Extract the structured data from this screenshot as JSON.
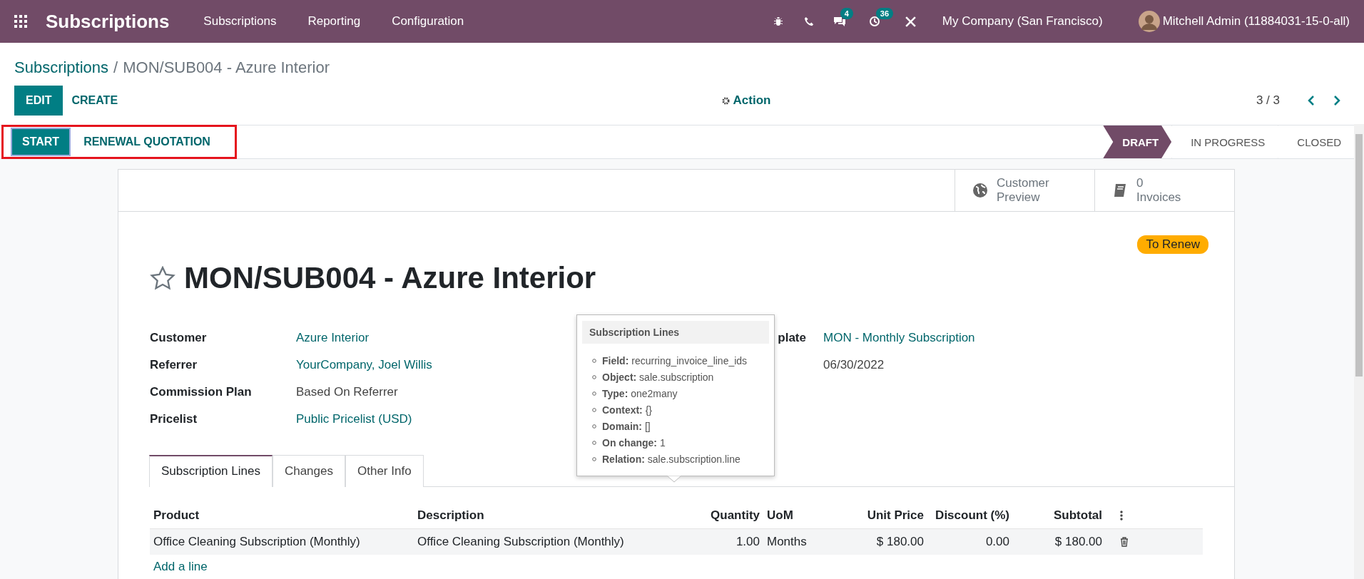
{
  "navbar": {
    "app_title": "Subscriptions",
    "menu": [
      "Subscriptions",
      "Reporting",
      "Configuration"
    ],
    "messages_badge": "4",
    "activities_badge": "36",
    "company": "My Company (San Francisco)",
    "user": "Mitchell Admin (11884031-15-0-all)"
  },
  "breadcrumb": {
    "parent": "Subscriptions",
    "separator": "/",
    "current": "MON/SUB004 - Azure Interior"
  },
  "control_panel": {
    "edit": "EDIT",
    "create": "CREATE",
    "action": "Action",
    "pager": "3 / 3"
  },
  "header_buttons": [
    {
      "label": "START",
      "kind": "primary"
    },
    {
      "label": "RENEWAL QUOTATION",
      "kind": "secondary"
    }
  ],
  "stages": [
    {
      "label": "DRAFT",
      "selected": true
    },
    {
      "label": "IN PROGRESS",
      "selected": false
    },
    {
      "label": "CLOSED",
      "selected": false
    }
  ],
  "smart_buttons": [
    {
      "line1": "Customer",
      "line2": "Preview",
      "kind": "globe"
    },
    {
      "line1": "0",
      "line2": "Invoices",
      "kind": "book"
    }
  ],
  "ribbon": "To Renew",
  "title": "MON/SUB004 - Azure Interior",
  "left_fields": [
    {
      "label": "Customer",
      "value": "Azure Interior",
      "link": true
    },
    {
      "label": "Referrer",
      "value": "YourCompany, Joel Willis",
      "link": true
    },
    {
      "label": "Commission Plan",
      "value": "Based On Referrer",
      "link": false
    },
    {
      "label": "Pricelist",
      "value": "Public Pricelist (USD)",
      "link": true
    }
  ],
  "right_fields": [
    {
      "label": "plate",
      "value": "MON - Monthly Subscription",
      "link": true
    },
    {
      "value": "06/30/2022",
      "link": false
    }
  ],
  "tabs": [
    {
      "label": "Subscription Lines",
      "selected": true
    },
    {
      "label": "Changes",
      "selected": false
    },
    {
      "label": "Other Info",
      "selected": false
    }
  ],
  "tooltip": {
    "title": "Subscription Lines",
    "items": [
      {
        "key": "Field:",
        "value": "recurring_invoice_line_ids"
      },
      {
        "key": "Object:",
        "value": "sale.subscription"
      },
      {
        "key": "Type:",
        "value": "one2many"
      },
      {
        "key": "Context:",
        "value": "{}"
      },
      {
        "key": "Domain:",
        "value": "[]"
      },
      {
        "key": "On change:",
        "value": "1"
      },
      {
        "key": "Relation:",
        "value": "sale.subscription.line"
      }
    ]
  },
  "table": {
    "columns": [
      "Product",
      "Description",
      "Quantity",
      "UoM",
      "Unit Price",
      "Discount (%)",
      "Subtotal"
    ],
    "rows": [
      [
        "Office Cleaning Subscription (Monthly)",
        "Office Cleaning Subscription (Monthly)",
        "1.00",
        "Months",
        "$ 180.00",
        "0.00",
        "$ 180.00"
      ]
    ],
    "add_line": "Add a line"
  }
}
